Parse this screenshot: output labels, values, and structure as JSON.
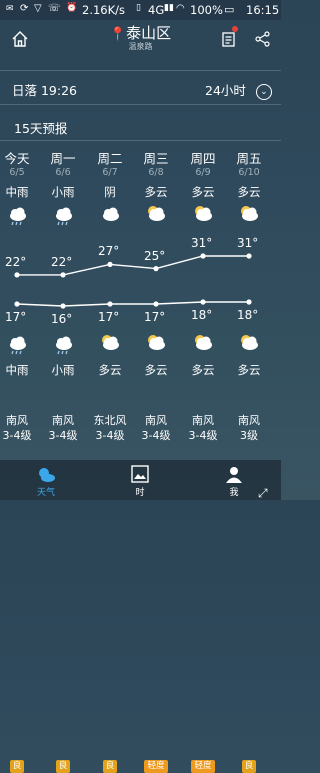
{
  "status": {
    "network": "2.16K/s",
    "signal": "4G",
    "battery": "100%",
    "time": "16:15"
  },
  "header": {
    "city": "泰山区",
    "district": "温泉路"
  },
  "sunset": "日落 19:26",
  "hours_toggle": "24小时",
  "forecast_title": "15天预报",
  "days": [
    {
      "day": "今天",
      "date": "6/5",
      "cond_day": "中雨",
      "cond_night": "中雨",
      "high": "22°",
      "low": "17°",
      "aqi": "良",
      "wind_dir": "南风",
      "wind_level": "3-4级"
    },
    {
      "day": "周一",
      "date": "6/6",
      "cond_day": "小雨",
      "cond_night": "小雨",
      "high": "22°",
      "low": "16°",
      "aqi": "良",
      "wind_dir": "南风",
      "wind_level": "3-4级"
    },
    {
      "day": "周二",
      "date": "6/7",
      "cond_day": "阴",
      "cond_night": "多云",
      "high": "27°",
      "low": "17°",
      "aqi": "良",
      "wind_dir": "东北风",
      "wind_level": "3-4级"
    },
    {
      "day": "周三",
      "date": "6/8",
      "cond_day": "多云",
      "cond_night": "多云",
      "high": "25°",
      "low": "17°",
      "aqi": "轻度",
      "wind_dir": "南风",
      "wind_level": "3-4级"
    },
    {
      "day": "周四",
      "date": "6/9",
      "cond_day": "多云",
      "cond_night": "多云",
      "high": "31°",
      "low": "18°",
      "aqi": "轻度",
      "wind_dir": "南风",
      "wind_level": "3-4级"
    },
    {
      "day": "周五",
      "date": "6/10",
      "cond_day": "多云",
      "cond_night": "多云",
      "high": "31°",
      "low": "18°",
      "aqi": "良",
      "wind_dir": "南风",
      "wind_level": "3级"
    }
  ],
  "tabs": [
    {
      "label": "天气",
      "active": true
    },
    {
      "label": "时",
      "active": false
    },
    {
      "label": "",
      "active": false
    },
    {
      "label": "我",
      "active": false
    }
  ],
  "colors": {
    "aqi_good": "#e2a21c",
    "aqi_light": "#ee9a1f",
    "accent": "#3aa7ea",
    "sunny": "#f5c84c"
  }
}
